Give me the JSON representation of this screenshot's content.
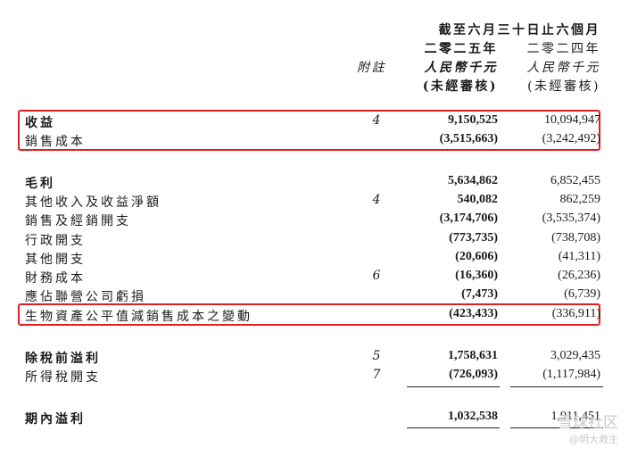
{
  "header": {
    "period": "截至六月三十日止六個月",
    "year_current": "二零二五年",
    "year_prior": "二零二四年",
    "note_label": "附註",
    "currency_current": "人民幣千元",
    "currency_prior": "人民幣千元",
    "audit_current": "(未經審核)",
    "audit_prior": "(未經審核)"
  },
  "rows": [
    {
      "label": "收益",
      "note": "4",
      "current": "9,150,525",
      "prior": "10,094,947"
    },
    {
      "label": "銷售成本",
      "note": "",
      "current": "(3,515,663)",
      "prior": "(3,242,492)"
    },
    {
      "label": "毛利",
      "note": "",
      "current": "5,634,862",
      "prior": "6,852,455"
    },
    {
      "label": "其他收入及收益淨額",
      "note": "4",
      "current": "540,082",
      "prior": "862,259"
    },
    {
      "label": "銷售及經銷開支",
      "note": "",
      "current": "(3,174,706)",
      "prior": "(3,535,374)"
    },
    {
      "label": "行政開支",
      "note": "",
      "current": "(773,735)",
      "prior": "(738,708)"
    },
    {
      "label": "其他開支",
      "note": "",
      "current": "(20,606)",
      "prior": "(41,311)"
    },
    {
      "label": "財務成本",
      "note": "6",
      "current": "(16,360)",
      "prior": "(26,236)"
    },
    {
      "label": "應佔聯營公司虧損",
      "note": "",
      "current": "(7,473)",
      "prior": "(6,739)"
    },
    {
      "label": "生物資產公平值減銷售成本之變動",
      "note": "",
      "current": "(423,433)",
      "prior": "(336,911)"
    },
    {
      "label": "除稅前溢利",
      "note": "5",
      "current": "1,758,631",
      "prior": "3,029,435"
    },
    {
      "label": "所得稅開支",
      "note": "7",
      "current": "(726,093)",
      "prior": "(1,117,984)"
    },
    {
      "label": "期內溢利",
      "note": "",
      "current": "1,032,538",
      "prior": "1,911,451"
    }
  ],
  "watermark": {
    "line1": "雪球社区",
    "line2": "@明大救主"
  }
}
